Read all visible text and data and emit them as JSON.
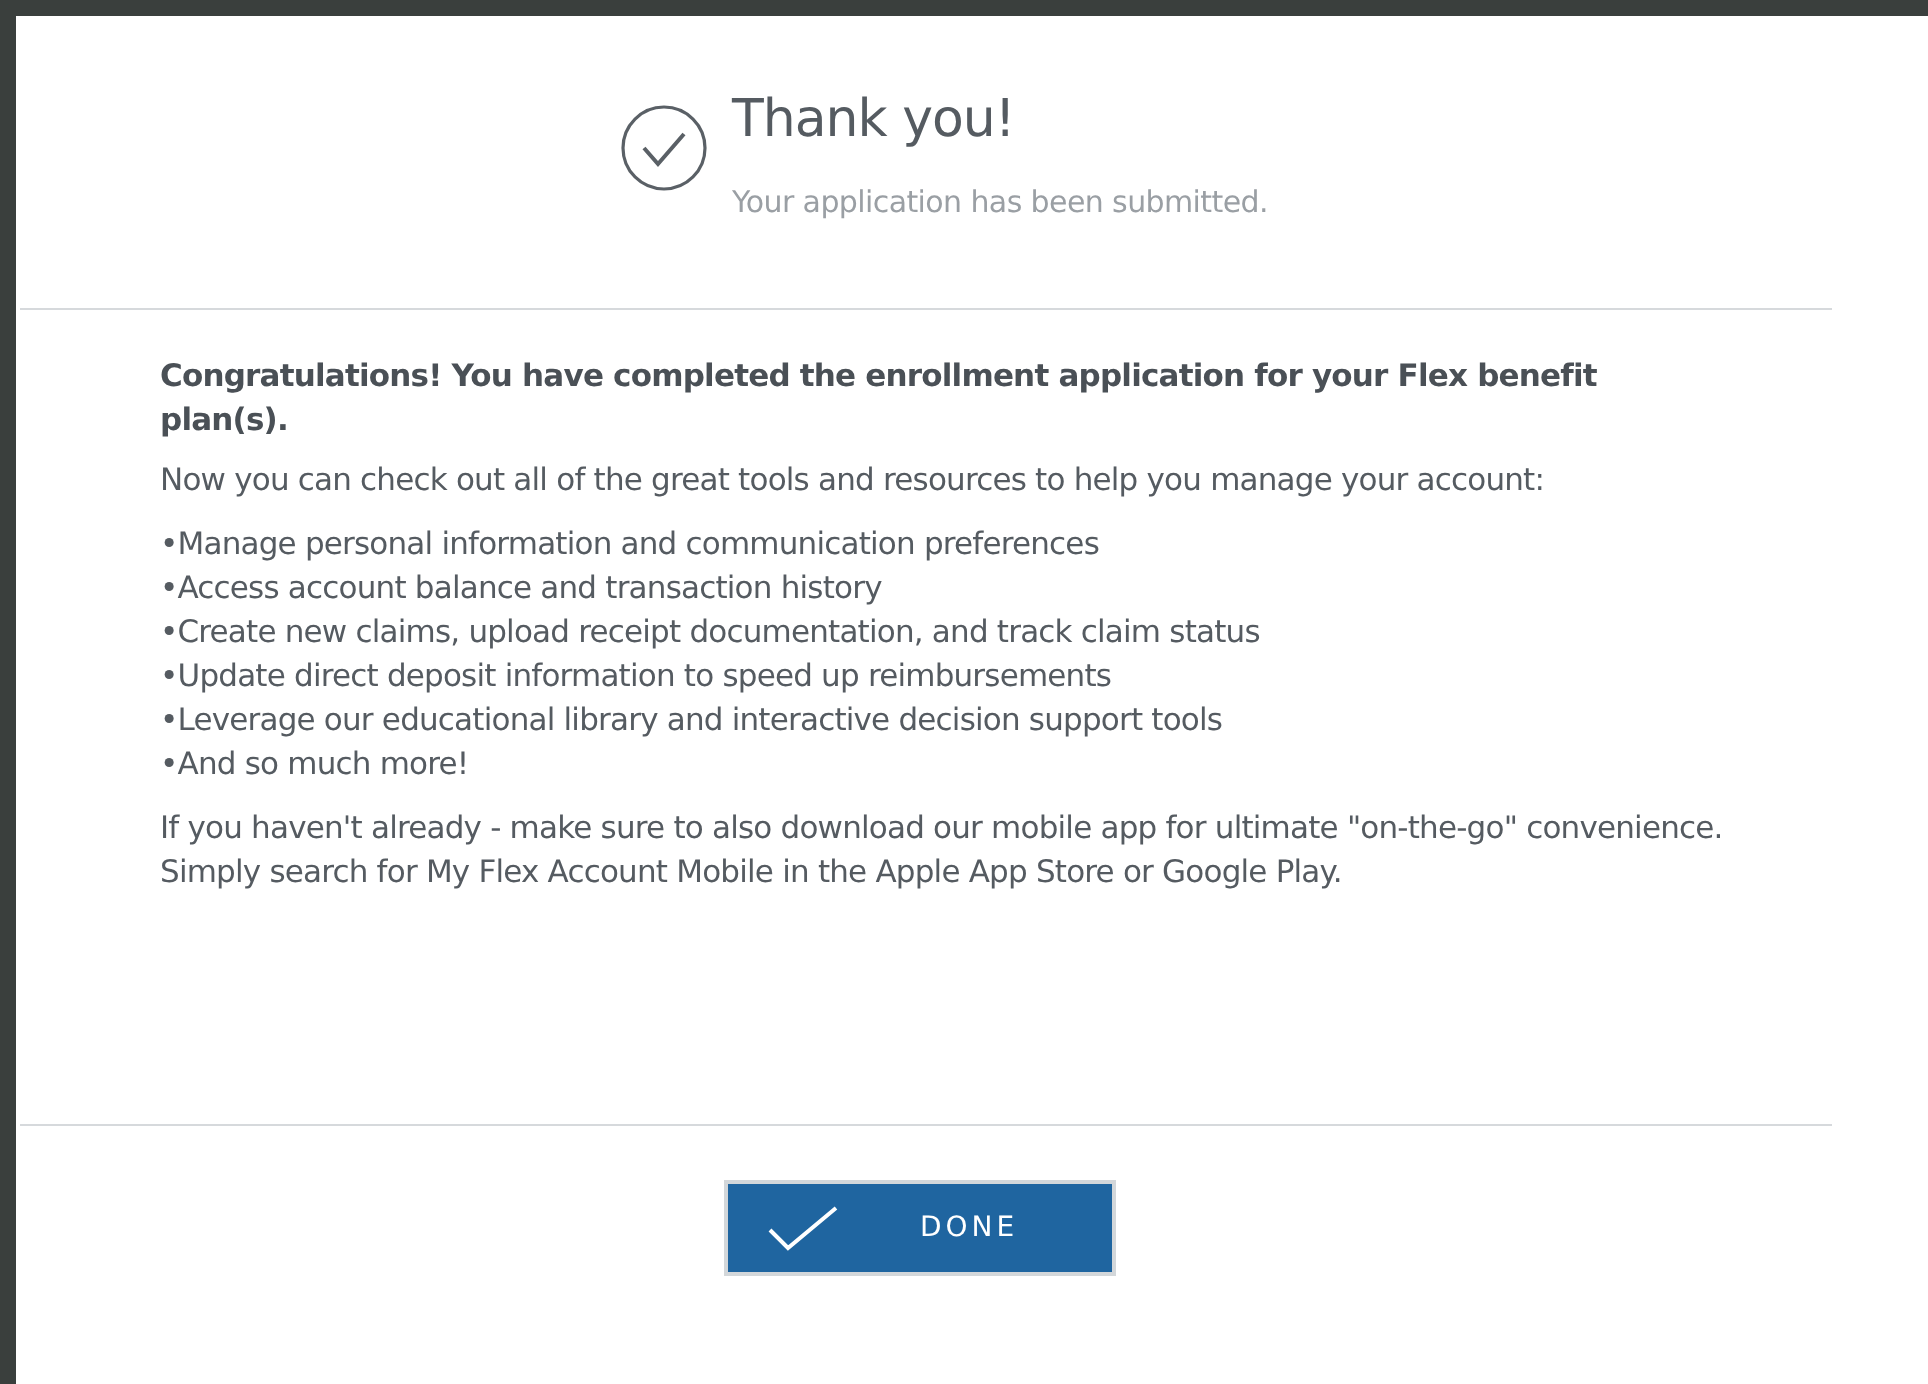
{
  "header": {
    "title": "Thank you!",
    "subtitle": "Your application has been submitted."
  },
  "body": {
    "heading": "Congratulations! You have completed the enrollment application for your Flex benefit plan(s).",
    "intro": "Now you can check out all of the great tools and resources to help you manage your account:",
    "bullets": [
      "•Manage personal information and communication preferences",
      "•Access account balance and transaction history",
      "•Create new claims, upload receipt documentation, and track claim status",
      "•Update direct deposit information to speed up reimbursements",
      "•Leverage our educational library and interactive decision support tools",
      "•And so much more!"
    ],
    "closing": "If you haven't already - make sure to also download our mobile app for ultimate \"on-the-go\" convenience. Simply search for My Flex Account Mobile in the Apple App Store or Google Play."
  },
  "button": {
    "label": "DONE"
  }
}
